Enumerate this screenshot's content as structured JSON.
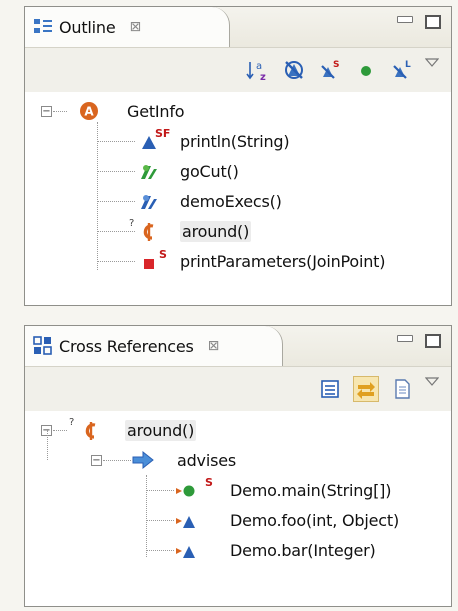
{
  "outline": {
    "tab_title": "Outline",
    "close_glyph": "⊠",
    "toolbar": [
      "sort-alpha-icon",
      "hide-fields-icon",
      "hide-static-icon",
      "hide-non-public-icon",
      "hide-local-types-icon"
    ],
    "root": {
      "label": "GetInfo",
      "toggle": "−",
      "icon": "aspect-icon",
      "icon_letter": "A"
    },
    "children": [
      {
        "label": "println(String)",
        "icon": "pointcut-icon",
        "badge": "SF"
      },
      {
        "label": "goCut()",
        "icon": "pointcut-green-icon",
        "badge": ""
      },
      {
        "label": "demoExecs()",
        "icon": "pointcut-blue-icon",
        "badge": ""
      },
      {
        "label": "around()",
        "icon": "around-advice-icon",
        "badge": "",
        "prefix": "?"
      },
      {
        "label": "printParameters(JoinPoint)",
        "icon": "private-method-icon",
        "badge": "S"
      }
    ]
  },
  "cross_references": {
    "tab_title": "Cross References",
    "close_glyph": "⊠",
    "toolbar": [
      "collapse-all-icon",
      "link-with-editor-icon",
      "show-file-icon"
    ],
    "root": {
      "label": "around()",
      "toggle": "−",
      "icon": "around-advice-icon",
      "prefix": "?"
    },
    "relation": {
      "label": "advises",
      "toggle": "−",
      "icon": "advises-arrow-icon"
    },
    "targets": [
      {
        "label": "Demo.main(String[])",
        "icon": "advised-public-method-icon",
        "badge": "S"
      },
      {
        "label": "Demo.foo(int, Object)",
        "icon": "advised-method-icon",
        "badge": ""
      },
      {
        "label": "Demo.bar(Integer)",
        "icon": "advised-method-icon",
        "badge": ""
      }
    ]
  },
  "colors": {
    "aspect": "#d9651f",
    "pointcut_blue": "#2a5fb4",
    "pointcut_green": "#2e9a3a",
    "advice": "#d9651f",
    "private_method": "#d9262a",
    "arrow": "#4a8ed8"
  }
}
